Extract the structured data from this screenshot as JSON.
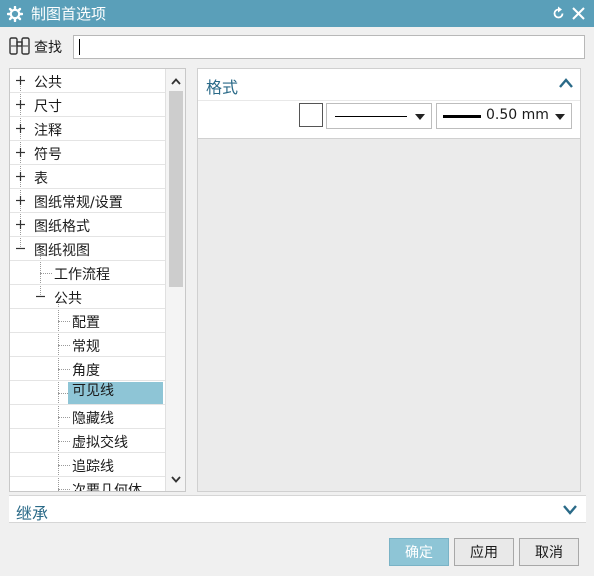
{
  "window": {
    "title": "制图首选项",
    "icon": "gear-icon",
    "title_bar_color": "#5a9fb9"
  },
  "search": {
    "label": "查找",
    "value": "",
    "icon": "binoculars-icon"
  },
  "tree": {
    "items": [
      {
        "label": "公共",
        "level": 0,
        "expander": "plus"
      },
      {
        "label": "尺寸",
        "level": 0,
        "expander": "plus"
      },
      {
        "label": "注释",
        "level": 0,
        "expander": "plus"
      },
      {
        "label": "符号",
        "level": 0,
        "expander": "plus"
      },
      {
        "label": "表",
        "level": 0,
        "expander": "plus"
      },
      {
        "label": "图纸常规/设置",
        "level": 0,
        "expander": "plus"
      },
      {
        "label": "图纸格式",
        "level": 0,
        "expander": "plus"
      },
      {
        "label": "图纸视图",
        "level": 0,
        "expander": "minus"
      },
      {
        "label": "工作流程",
        "level": 1,
        "expander": "none"
      },
      {
        "label": "公共",
        "level": 1,
        "expander": "minus"
      },
      {
        "label": "配置",
        "level": 2,
        "expander": "none"
      },
      {
        "label": "常规",
        "level": 2,
        "expander": "none"
      },
      {
        "label": "角度",
        "level": 2,
        "expander": "none"
      },
      {
        "label": "可见线",
        "level": 2,
        "expander": "none",
        "selected": true
      },
      {
        "label": "隐藏线",
        "level": 2,
        "expander": "none"
      },
      {
        "label": "虚拟交线",
        "level": 2,
        "expander": "none"
      },
      {
        "label": "追踪线",
        "level": 2,
        "expander": "none"
      },
      {
        "label": "次要几何体",
        "level": 2,
        "expander": "none"
      }
    ],
    "selected_color": "#8ec5d6"
  },
  "format_section": {
    "header": "格式",
    "color_swatch": "#ffffff",
    "line_type": "solid",
    "line_width": "0.50 mm"
  },
  "inherit_section": {
    "header": "继承"
  },
  "buttons": {
    "ok": "确定",
    "apply": "应用",
    "cancel": "取消"
  },
  "accent_color": "#2a6a88"
}
